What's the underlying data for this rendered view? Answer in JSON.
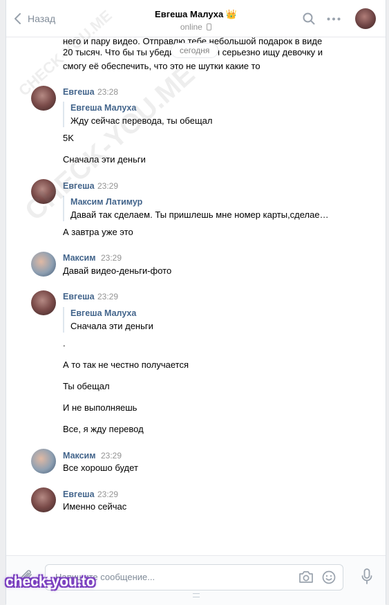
{
  "header": {
    "back_label": "Назад",
    "peer_name": "Евгеша Малуха 👑",
    "status": "online"
  },
  "date_divider": "сегодня",
  "history": {
    "top_lines": [
      "него и пару видео. Отправлю тебе небольшой подарок в виде",
      "20 тысяч. Что бы ты убедилась, что я серьезно ищу девочку и",
      "смогу её обеспечить, что это не шутки какие то"
    ],
    "messages": [
      {
        "author": "Евгеша",
        "time": "23:28",
        "fwd_author": "Евгеша Малуха",
        "fwd_text": "Жду сейчас перевода, ты обещал",
        "lines": [
          "5K",
          "Сначала эти деньги"
        ]
      },
      {
        "author": "Евгеша",
        "time": "23:29",
        "fwd_author": "Максим Латимур",
        "fwd_text": "Давай так сделаем. Ты пришлешь мне номер карты,сделае…",
        "lines": [
          "А завтра уже это"
        ]
      },
      {
        "author": "Максим",
        "time": "23:29",
        "lines": [
          "Давай видео-деньги-фото"
        ]
      },
      {
        "author": "Евгеша",
        "time": "23:29",
        "fwd_author": "Евгеша Малуха",
        "fwd_text": "Сначала эти деньги",
        "lines": [
          ".",
          "А то так не честно получается",
          "Ты обещал",
          "И не выполняешь",
          "Все, я жду перевод"
        ]
      },
      {
        "author": "Максим",
        "time": "23:29",
        "lines": [
          "Все хорошо будет"
        ]
      },
      {
        "author": "Евгеша",
        "time": "23:29",
        "lines": [
          "Именно сейчас"
        ]
      }
    ]
  },
  "composer": {
    "placeholder": "Напишите сообщение..."
  },
  "watermarks": {
    "diagonal": "CHECK-YOU.ME",
    "badge": "check-you.to"
  },
  "colors": {
    "author_link": "#42648b",
    "muted": "#939393",
    "page_bg": "#edeef0"
  }
}
